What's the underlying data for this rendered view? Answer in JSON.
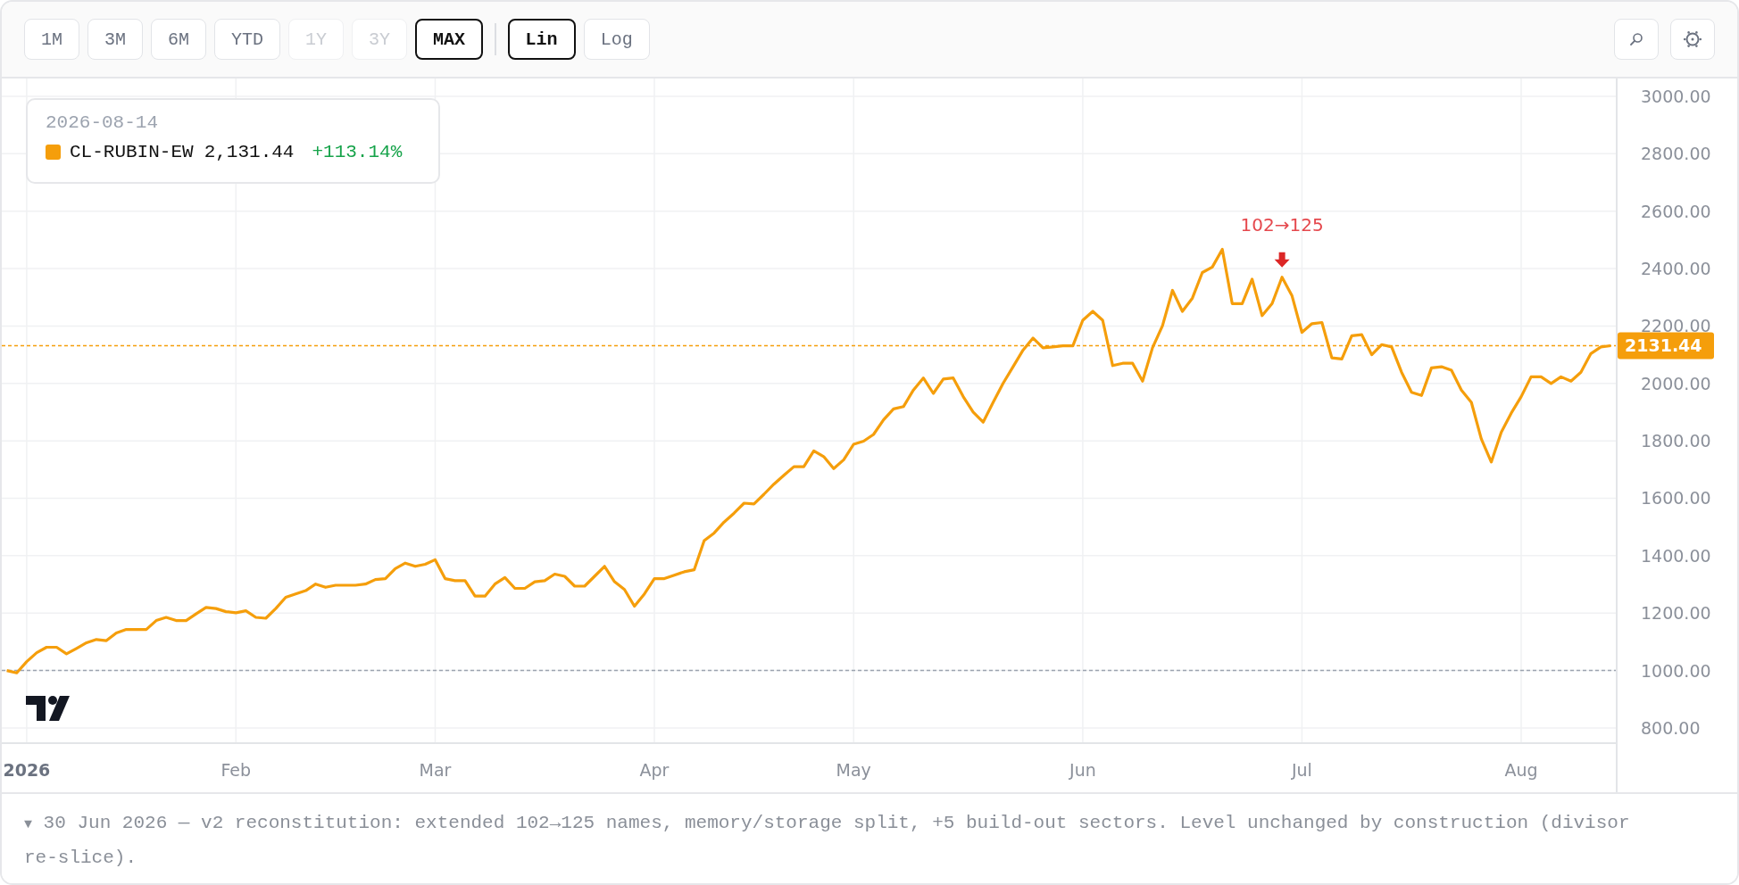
{
  "toolbar": {
    "ranges": [
      {
        "label": "1M",
        "selected": false,
        "disabled": false
      },
      {
        "label": "3M",
        "selected": false,
        "disabled": false
      },
      {
        "label": "6M",
        "selected": false,
        "disabled": false
      },
      {
        "label": "YTD",
        "selected": false,
        "disabled": false
      },
      {
        "label": "1Y",
        "selected": false,
        "disabled": true
      },
      {
        "label": "3Y",
        "selected": false,
        "disabled": true
      },
      {
        "label": "MAX",
        "selected": true,
        "disabled": false
      }
    ],
    "scales": [
      {
        "label": "Lin",
        "selected": true
      },
      {
        "label": "Log",
        "selected": false
      }
    ]
  },
  "legend": {
    "date": "2026-08-14",
    "value": "2,131.44",
    "change": "+113.14%"
  },
  "chart": {
    "chart_data": {
      "type": "line",
      "grid": true,
      "ylim": [
        747,
        3062
      ],
      "categories": [
        null,
        null,
        "2026",
        null,
        null,
        null,
        null,
        null,
        null,
        null,
        null,
        null,
        null,
        null,
        null,
        null,
        null,
        null,
        null,
        null,
        null,
        null,
        null,
        "Feb",
        null,
        null,
        null,
        null,
        null,
        null,
        null,
        null,
        null,
        null,
        null,
        null,
        null,
        null,
        null,
        null,
        null,
        null,
        null,
        "Mar",
        null,
        null,
        null,
        null,
        null,
        null,
        null,
        null,
        null,
        null,
        null,
        null,
        null,
        null,
        null,
        null,
        null,
        null,
        null,
        null,
        null,
        "Apr",
        null,
        null,
        null,
        null,
        null,
        null,
        null,
        null,
        null,
        null,
        null,
        null,
        null,
        null,
        null,
        null,
        null,
        null,
        null,
        "May",
        null,
        null,
        null,
        null,
        null,
        null,
        null,
        null,
        null,
        null,
        null,
        null,
        null,
        null,
        null,
        null,
        null,
        null,
        null,
        null,
        null,
        null,
        "Jun",
        null,
        null,
        null,
        null,
        null,
        null,
        null,
        null,
        null,
        null,
        null,
        null,
        null,
        null,
        null,
        null,
        null,
        null,
        null,
        null,
        null,
        "Jul",
        null,
        null,
        null,
        null,
        null,
        null,
        null,
        null,
        null,
        null,
        null,
        null,
        null,
        null,
        null,
        null,
        null,
        null,
        null,
        null,
        null,
        "Aug",
        null,
        null,
        null,
        null,
        null,
        null,
        null,
        null,
        null
      ],
      "yticks": [
        {
          "value": 800,
          "label": "800.00"
        },
        {
          "value": 1000,
          "label": "1000.00"
        },
        {
          "value": 1200,
          "label": "1200.00"
        },
        {
          "value": 1400,
          "label": "1400.00"
        },
        {
          "value": 1600,
          "label": "1600.00"
        },
        {
          "value": 1800,
          "label": "1800.00"
        },
        {
          "value": 2000,
          "label": "2000.00"
        },
        {
          "value": 2200,
          "label": "2200.00"
        },
        {
          "value": 2400,
          "label": "2400.00"
        },
        {
          "value": 2600,
          "label": "2600.00"
        },
        {
          "value": 2800,
          "label": "2800.00"
        },
        {
          "value": 3000,
          "label": "3000.00"
        }
      ],
      "series": [
        {
          "name": "CL-RUBIN-EW",
          "color": "#f59e0b",
          "values": [
            1000,
            992,
            1031,
            1062,
            1081,
            1081,
            1058,
            1077,
            1097,
            1108,
            1104,
            1131,
            1143,
            1143,
            1143,
            1174,
            1185,
            1174,
            1174,
            1197,
            1220,
            1216,
            1205,
            1201,
            1208,
            1185,
            1182,
            1216,
            1255,
            1267,
            1278,
            1301,
            1290,
            1297,
            1297,
            1297,
            1301,
            1317,
            1320,
            1355,
            1374,
            1363,
            1370,
            1386,
            1320,
            1313,
            1313,
            1259,
            1259,
            1301,
            1324,
            1286,
            1286,
            1309,
            1313,
            1336,
            1328,
            1294,
            1294,
            1328,
            1363,
            1309,
            1282,
            1224,
            1267,
            1320,
            1320,
            1332,
            1344,
            1351,
            1452,
            1479,
            1517,
            1548,
            1583,
            1580,
            1614,
            1649,
            1680,
            1710,
            1710,
            1765,
            1745,
            1703,
            1734,
            1788,
            1799,
            1822,
            1873,
            1911,
            1919,
            1977,
            2019,
            1965,
            2015,
            2019,
            1954,
            1900,
            1865,
            1934,
            2000,
            2058,
            2116,
            2158,
            2124,
            2127,
            2131,
            2131,
            2220,
            2251,
            2220,
            2062,
            2070,
            2070,
            2008,
            2124,
            2201,
            2324,
            2251,
            2297,
            2386,
            2405,
            2467,
            2278,
            2278,
            2363,
            2236,
            2278,
            2370,
            2305,
            2178,
            2208,
            2212,
            2089,
            2085,
            2166,
            2170,
            2100,
            2135,
            2127,
            2039,
            1969,
            1958,
            2054,
            2058,
            2046,
            1977,
            1934,
            1807,
            1726,
            1830,
            1896,
            1954,
            2023,
            2023,
            2000,
            2023,
            2008,
            2039,
            2104,
            2127,
            2131.44
          ]
        }
      ],
      "annotations": [
        {
          "y": 2370,
          "text": "102→125"
        }
      ],
      "ref_lines": [
        {
          "axis": "y",
          "value": 2131.44,
          "label": "2131.44",
          "color": "#f59e0b"
        },
        {
          "axis": "y",
          "value": 1000,
          "color": "#9ca3af"
        }
      ]
    }
  },
  "note": {
    "toggle": "▼",
    "text": "30 Jun 2026 — v2 reconstitution: extended 102→125 names, memory/storage split, +5 build-out sectors. Level unchanged by construction (divisor re-slice)."
  }
}
